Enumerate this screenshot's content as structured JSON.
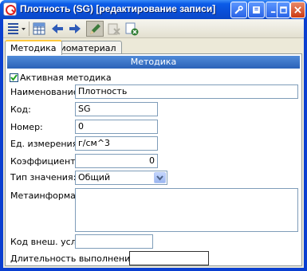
{
  "window": {
    "title": "Плотность (SG) [редактирование записи]"
  },
  "toolbar": {
    "buttons": [
      "list-menu",
      "table",
      "back-arrow",
      "forward-arrow",
      "edit-pen",
      "delete",
      "close-record"
    ]
  },
  "tabs": [
    {
      "label": "Методика",
      "active": true
    },
    {
      "label": "Биоматериал",
      "active": false
    }
  ],
  "section": {
    "header": "Методика"
  },
  "form": {
    "active": {
      "label": "Активная методика",
      "checked": true
    },
    "name": {
      "label": "Наименование:",
      "value": "Плотность"
    },
    "code": {
      "label": "Код:",
      "value": "SG"
    },
    "number": {
      "label": "Номер:",
      "value": "0"
    },
    "unit": {
      "label": "Ед. измерения:",
      "value": "г/см^3"
    },
    "coefficient": {
      "label": "Коэффициент:",
      "value": "0"
    },
    "value_type": {
      "label": "Тип значения:",
      "value": "Общий"
    },
    "meta": {
      "label": "Метаинформация:",
      "value": ""
    },
    "ext_code": {
      "label": "Код внеш. услуги:",
      "value": ""
    },
    "duration": {
      "label": "Длительность выполнения (дн.):",
      "value": ""
    }
  },
  "colors": {
    "titlebar": "#0a4fd8",
    "section_header": "#2b62b8",
    "client_bg": "#ece9d8",
    "field_border": "#7f9db9"
  }
}
